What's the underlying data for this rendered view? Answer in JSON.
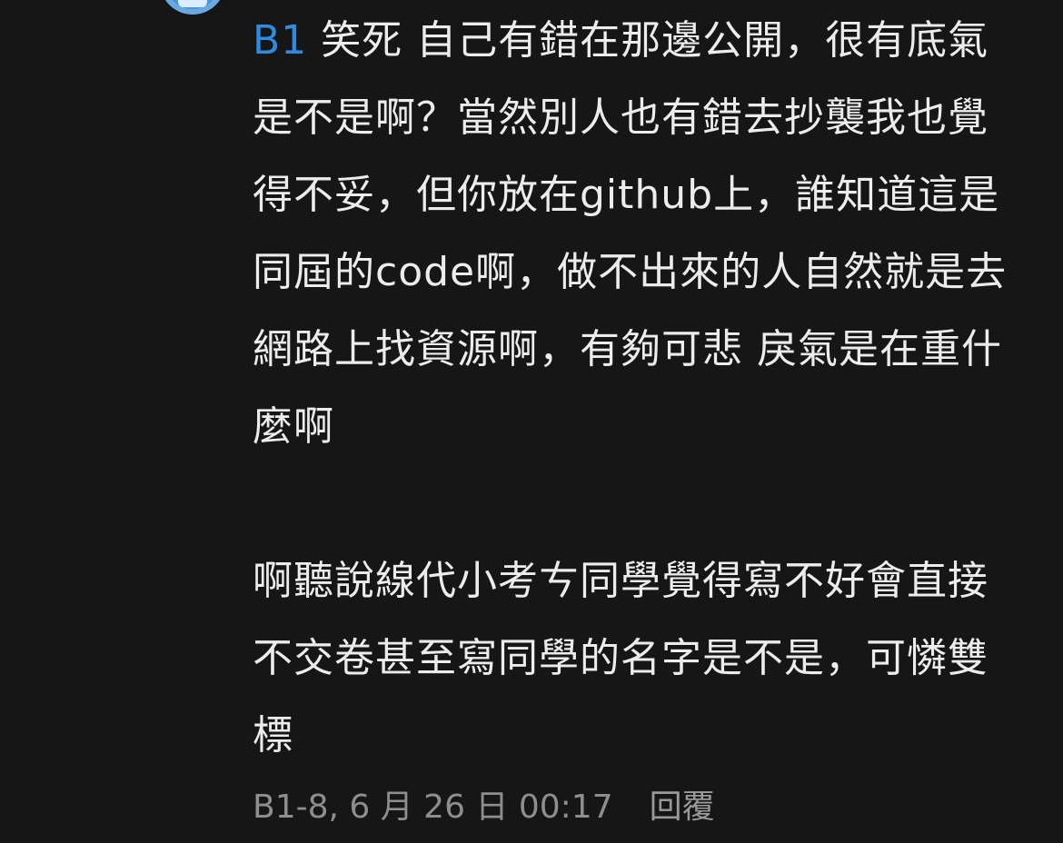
{
  "comment": {
    "floor_tag": "B1",
    "paragraphs": [
      " 笑死 自己有錯在那邊公開，很有底氣是不是啊？當然別人也有錯去抄襲我也覺得不妥，但你放在github上，誰知道這是同屆的code啊，做不出來的人自然就是去網路上找資源啊，有夠可悲 戾氣是在重什麼啊",
      "啊聽說線代小考ㄘ同學覺得寫不好會直接不交卷甚至寫同學的名字是不是，可憐雙標"
    ],
    "meta": "B1-8, 6 月 26 日 00:17",
    "reply_label": "回覆"
  },
  "colors": {
    "background": "#161616",
    "text": "#ececec",
    "floor_tag": "#2f8be0",
    "meta": "#8e8e8e",
    "avatar": "#4a93d8"
  },
  "icons": {
    "avatar": "user-avatar-icon"
  }
}
